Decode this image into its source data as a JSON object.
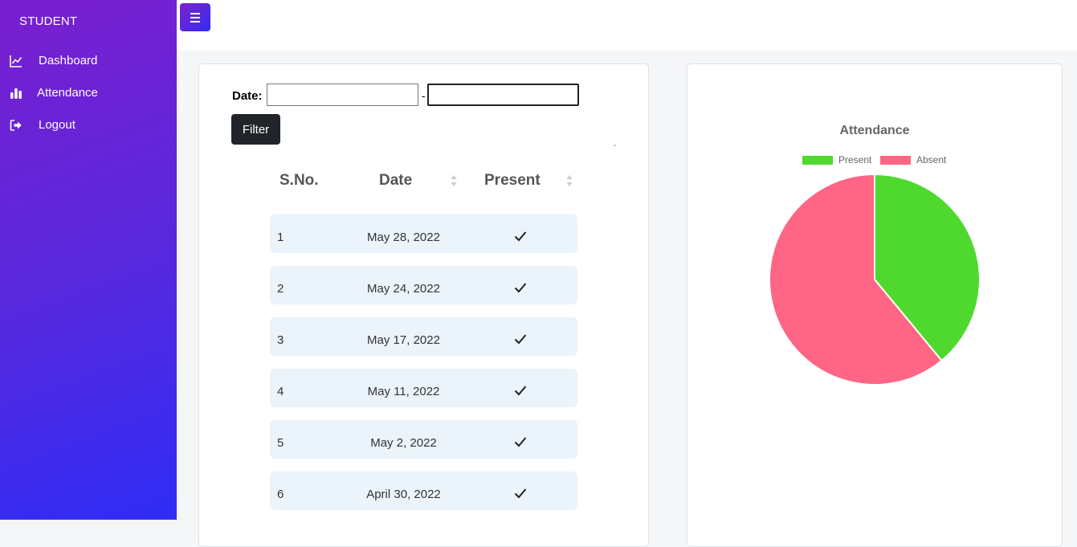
{
  "sidebar": {
    "brand": "STUDENT",
    "items": [
      {
        "label": "Dashboard",
        "icon": "line-chart-icon"
      },
      {
        "label": "Attendance",
        "icon": "bar-chart-icon"
      },
      {
        "label": "Logout",
        "icon": "logout-icon"
      }
    ]
  },
  "topbar": {
    "menu_icon": "hamburger-icon",
    "accent": "#5a28dc"
  },
  "filter": {
    "date_label": "Date:",
    "from_value": "",
    "to_value": "",
    "separator": "-",
    "button_label": "Filter"
  },
  "table": {
    "headers": [
      "S.No.",
      "Date",
      "Present"
    ],
    "rows": [
      {
        "sno": "1",
        "date": "May 28, 2022",
        "present": true
      },
      {
        "sno": "2",
        "date": "May 24, 2022",
        "present": true
      },
      {
        "sno": "3",
        "date": "May 17, 2022",
        "present": true
      },
      {
        "sno": "4",
        "date": "May 11, 2022",
        "present": true
      },
      {
        "sno": "5",
        "date": "May 2, 2022",
        "present": true
      },
      {
        "sno": "6",
        "date": "April 30, 2022",
        "present": true
      }
    ]
  },
  "chart": {
    "title": "Attendance",
    "legend": [
      {
        "label": "Present",
        "color": "#4fd92f"
      },
      {
        "label": "Absent",
        "color": "#ff6584"
      }
    ]
  },
  "chart_data": {
    "type": "pie",
    "title": "Attendance",
    "categories": [
      "Present",
      "Absent"
    ],
    "values": [
      39,
      61
    ],
    "colors": [
      "#4fd92f",
      "#ff6584"
    ],
    "legend_position": "top"
  }
}
